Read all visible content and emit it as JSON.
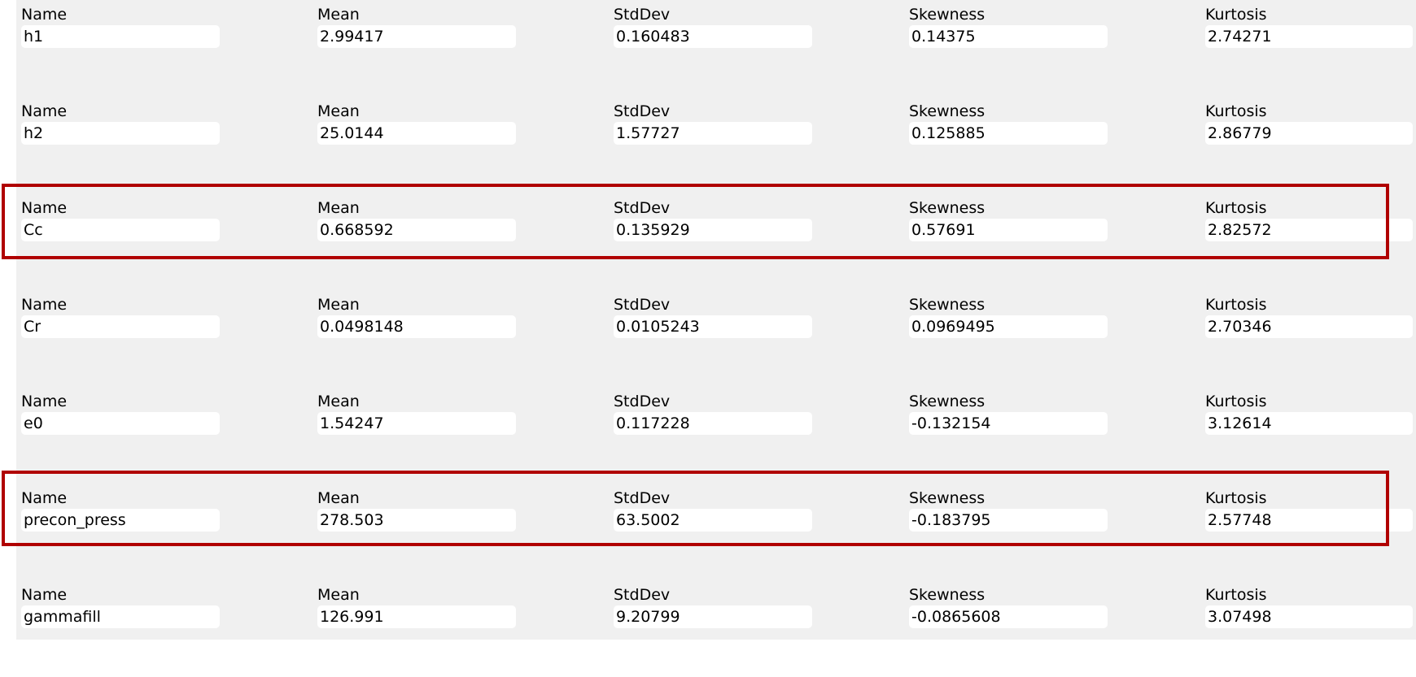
{
  "labels": {
    "name": "Name",
    "mean": "Mean",
    "stddev": "StdDev",
    "skewness": "Skewness",
    "kurtosis": "Kurtosis"
  },
  "rows": [
    {
      "name": "h1",
      "mean": "2.99417",
      "stddev": "0.160483",
      "skewness": "0.14375",
      "kurtosis": "2.74271"
    },
    {
      "name": "h2",
      "mean": "25.0144",
      "stddev": "1.57727",
      "skewness": "0.125885",
      "kurtosis": "2.86779"
    },
    {
      "name": "Cc",
      "mean": "0.668592",
      "stddev": "0.135929",
      "skewness": "0.57691",
      "kurtosis": "2.82572",
      "highlighted": true
    },
    {
      "name": "Cr",
      "mean": "0.0498148",
      "stddev": "0.0105243",
      "skewness": "0.0969495",
      "kurtosis": "2.70346"
    },
    {
      "name": "e0",
      "mean": "1.54247",
      "stddev": "0.117228",
      "skewness": "-0.132154",
      "kurtosis": "3.12614"
    },
    {
      "name": "precon_press",
      "mean": "278.503",
      "stddev": "63.5002",
      "skewness": "-0.183795",
      "kurtosis": "2.57748",
      "highlighted": true
    },
    {
      "name": "gammafill",
      "mean": "126.991",
      "stddev": "9.20799",
      "skewness": "-0.0865608",
      "kurtosis": "3.07498"
    }
  ],
  "colors": {
    "panel_background": "#f0f0f0",
    "field_background": "#ffffff",
    "highlight_border": "#b00000"
  }
}
